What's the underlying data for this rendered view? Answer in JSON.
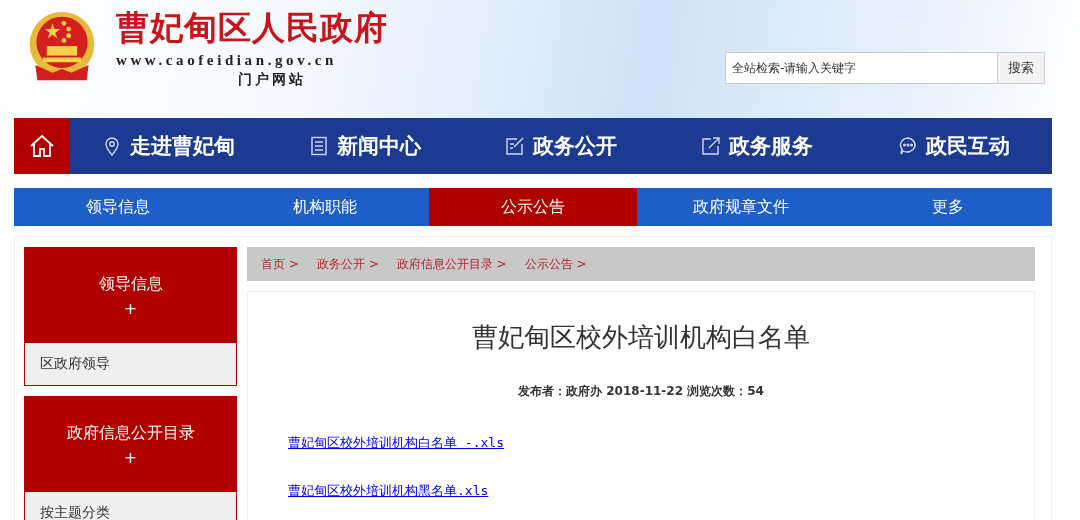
{
  "header": {
    "site_title": "曹妃甸区人民政府",
    "domain": "www.caofeidian.gov.cn",
    "subtitle": "门户网站"
  },
  "search": {
    "placeholder": "全站检索-请输入关键字",
    "button": "搜索"
  },
  "main_nav": [
    {
      "label": "走进曹妃甸"
    },
    {
      "label": "新闻中心"
    },
    {
      "label": "政务公开"
    },
    {
      "label": "政务服务"
    },
    {
      "label": "政民互动"
    }
  ],
  "sub_nav": [
    {
      "label": "领导信息",
      "selected": false
    },
    {
      "label": "机构职能",
      "selected": false
    },
    {
      "label": "公示公告",
      "selected": true
    },
    {
      "label": "政府规章文件",
      "selected": false
    },
    {
      "label": "更多",
      "selected": false
    }
  ],
  "sidebar": [
    {
      "title": "领导信息",
      "toggle": "+",
      "items": [
        "区政府领导"
      ]
    },
    {
      "title": "政府信息公开目录",
      "toggle": "+",
      "items": [
        "按主题分类"
      ]
    }
  ],
  "breadcrumb": [
    "首页 >",
    "政务公开 >",
    "政府信息公开目录 >",
    "公示公告 >"
  ],
  "article": {
    "title": "曹妃甸区校外培训机构白名单",
    "meta": "发布者：政府办 2018-11-22 浏览次数：54",
    "attachments": [
      "曹妃甸区校外培训机构白名单 -.xls",
      "曹妃甸区校外培训机构黑名单.xls"
    ]
  }
}
